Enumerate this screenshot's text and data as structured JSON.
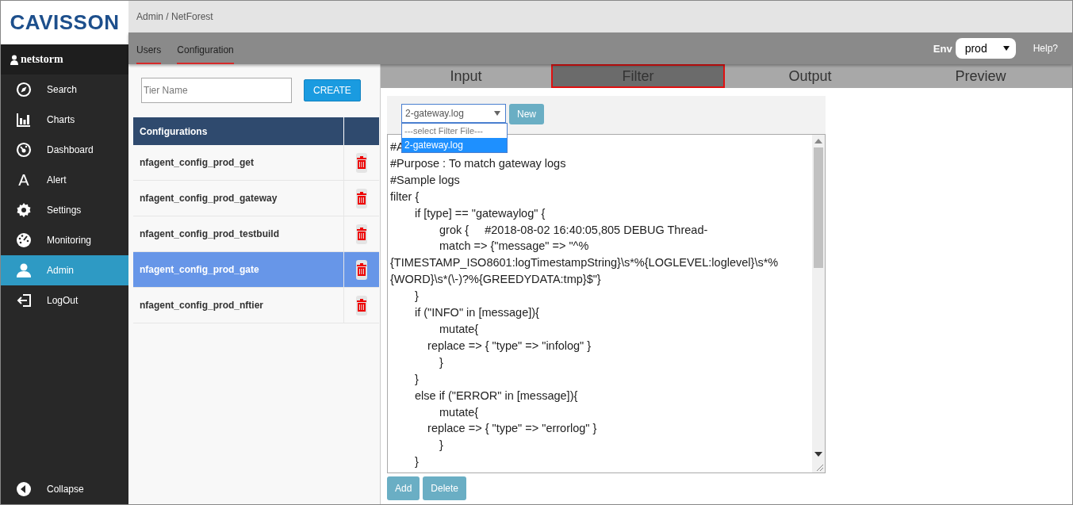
{
  "logo": "CAVISSON",
  "user": "netstorm",
  "nav": [
    {
      "label": "Search",
      "selected": false
    },
    {
      "label": "Charts",
      "selected": false
    },
    {
      "label": "Dashboard",
      "selected": false
    },
    {
      "label": "Alert",
      "selected": false,
      "icon_text": "A"
    },
    {
      "label": "Settings",
      "selected": false
    },
    {
      "label": "Monitoring",
      "selected": false
    },
    {
      "label": "Admin",
      "selected": true
    },
    {
      "label": "LogOut",
      "selected": false
    }
  ],
  "collapse": "Collapse",
  "breadcrumb": "Admin / NetForest",
  "top_tabs": [
    "Users",
    "Configuration"
  ],
  "env": {
    "label": "Env",
    "value": "prod"
  },
  "help": "Help?",
  "tier_field": {
    "placeholder": "Tier Name"
  },
  "create_button": "CREATE",
  "table": {
    "columns": [
      "Configurations"
    ],
    "rows": [
      {
        "name": "nfagent_config_prod_get",
        "selected": false
      },
      {
        "name": "nfagent_config_prod_gateway",
        "selected": false
      },
      {
        "name": "nfagent_config_prod_testbuild",
        "selected": false
      },
      {
        "name": "nfagent_config_prod_gate",
        "selected": true
      },
      {
        "name": "nfagent_config_prod_nftier",
        "selected": false
      }
    ]
  },
  "sub_tabs": [
    {
      "label": "Input",
      "selected": false
    },
    {
      "label": "Filter",
      "selected": true
    },
    {
      "label": "Output",
      "selected": false
    },
    {
      "label": "Preview",
      "selected": false
    }
  ],
  "filter_select": {
    "value": "2-gateway.log",
    "options": [
      {
        "label": "---select Filter File---",
        "selected": false
      },
      {
        "label": "2-gateway.log",
        "selected": true
      }
    ]
  },
  "new_button": "New",
  "editor_lines": [
    "#A",
    "#Purpose : To match gateway logs",
    "#Sample logs",
    "filter {",
    "\tif [type] == \"gatewaylog\" {",
    "\t\tgrok {     #2018-08-02 16:40:05,805 DEBUG Thread-",
    "\t\tmatch => {\"message\" => \"^%",
    "{TIMESTAMP_ISO8601:logTimestampString}\\s*%{LOGLEVEL:loglevel}\\s*%",
    "{WORD}\\s*(\\-)?%{GREEDYDATA:tmp}$\"}",
    "\t}",
    "\tif (\"INFO\" in [message]){",
    "\t\tmutate{",
    "\t    replace => { \"type\" => \"infolog\" }",
    "\t\t}",
    "\t}",
    "\telse if (\"ERROR\" in [message]){",
    "\t\tmutate{",
    "\t    replace => { \"type\" => \"errorlog\" }",
    "\t\t}",
    "\t}"
  ],
  "buttons": [
    "Add",
    "Delete"
  ]
}
